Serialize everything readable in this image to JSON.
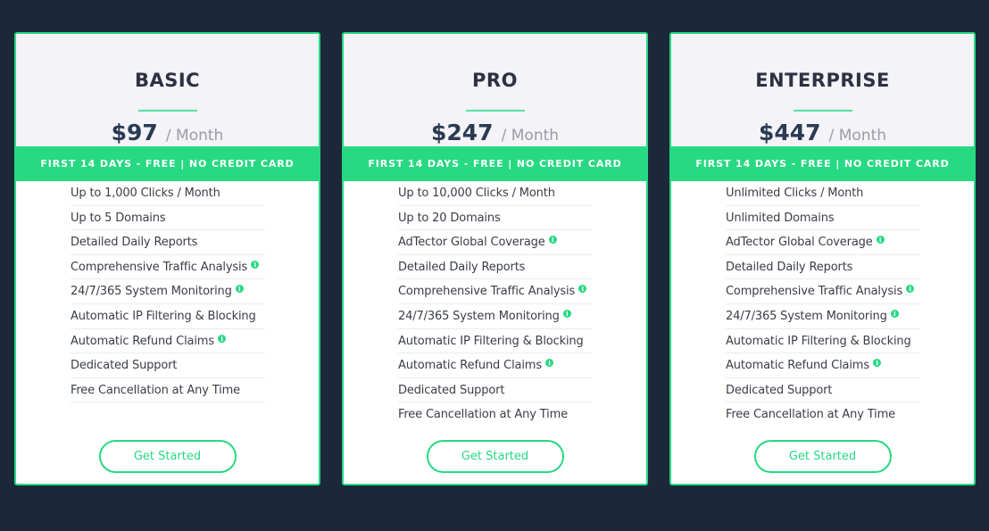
{
  "colors": {
    "background": "#1b2839",
    "accent": "#27d982",
    "card_header": "#f3f3f8",
    "heading": "#2d3142",
    "price": "#2a3a52",
    "period": "#9a9ca6"
  },
  "plans": [
    {
      "name": "BASIC",
      "price": "$97",
      "period": "/ Month",
      "trial_banner": "FIRST 14 DAYS - FREE | NO CREDIT CARD",
      "features": [
        {
          "label": "Up to 1,000 Clicks / Month",
          "info": false
        },
        {
          "label": "Up to 5 Domains",
          "info": false
        },
        {
          "label": "Detailed Daily Reports",
          "info": false
        },
        {
          "label": "Comprehensive Traffic Analysis",
          "info": true
        },
        {
          "label": "24/7/365 System Monitoring",
          "info": true
        },
        {
          "label": "Automatic IP Filtering & Blocking",
          "info": false
        },
        {
          "label": "Automatic Refund Claims",
          "info": true
        },
        {
          "label": "Dedicated Support",
          "info": false
        },
        {
          "label": "Free Cancellation at Any Time",
          "info": false
        }
      ],
      "cta_label": "Get Started"
    },
    {
      "name": "PRO",
      "price": "$247",
      "period": "/ Month",
      "trial_banner": "FIRST 14 DAYS - FREE | NO CREDIT CARD",
      "features": [
        {
          "label": "Up to 10,000 Clicks / Month",
          "info": false
        },
        {
          "label": "Up to 20 Domains",
          "info": false
        },
        {
          "label": "AdTector Global Coverage",
          "info": true
        },
        {
          "label": "Detailed Daily Reports",
          "info": false
        },
        {
          "label": "Comprehensive Traffic Analysis",
          "info": true
        },
        {
          "label": "24/7/365 System Monitoring",
          "info": true
        },
        {
          "label": "Automatic IP Filtering & Blocking",
          "info": false
        },
        {
          "label": "Automatic Refund Claims",
          "info": true
        },
        {
          "label": "Dedicated Support",
          "info": false
        },
        {
          "label": "Free Cancellation at Any Time",
          "info": false
        }
      ],
      "cta_label": "Get Started"
    },
    {
      "name": "ENTERPRISE",
      "price": "$447",
      "period": "/ Month",
      "trial_banner": "FIRST 14 DAYS - FREE | NO CREDIT CARD",
      "features": [
        {
          "label": "Unlimited Clicks / Month",
          "info": false
        },
        {
          "label": "Unlimited Domains",
          "info": false
        },
        {
          "label": "AdTector Global Coverage",
          "info": true
        },
        {
          "label": "Detailed Daily Reports",
          "info": false
        },
        {
          "label": "Comprehensive Traffic Analysis",
          "info": true
        },
        {
          "label": "24/7/365 System Monitoring",
          "info": true
        },
        {
          "label": "Automatic IP Filtering & Blocking",
          "info": false
        },
        {
          "label": "Automatic Refund Claims",
          "info": true
        },
        {
          "label": "Dedicated Support",
          "info": false
        },
        {
          "label": "Free Cancellation at Any Time",
          "info": false
        }
      ],
      "cta_label": "Get Started"
    }
  ],
  "info_icon_glyph": "i"
}
